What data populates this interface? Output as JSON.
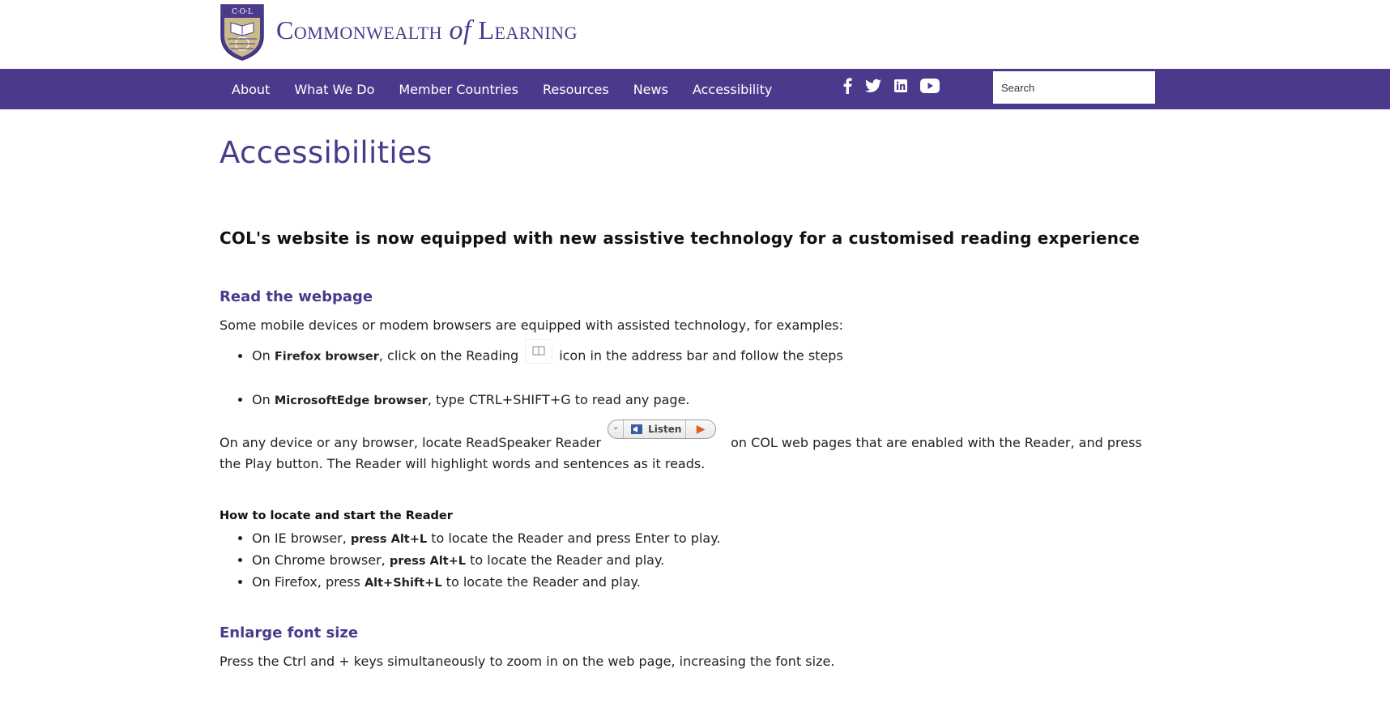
{
  "header": {
    "logo_text_pre": "Commonwealth ",
    "logo_text_of": "of",
    "logo_text_post": " Learning",
    "crest_text": "C·O·L"
  },
  "nav": {
    "items": [
      "About",
      "What We Do",
      "Member Countries",
      "Resources",
      "News",
      "Accessibility"
    ],
    "search_placeholder": "Search"
  },
  "social": [
    "facebook-icon",
    "twitter-icon",
    "linkedin-icon",
    "youtube-icon"
  ],
  "colors": {
    "brand": "#4b3a8c",
    "play": "#e05a1e"
  },
  "main": {
    "title": "Accessibilities",
    "lead": "COL's website is now equipped with new assistive technology for a customised reading experience",
    "section1": {
      "heading": "Read the webpage",
      "intro": "Some mobile devices or modem browsers are equipped with assisted technology, for examples:",
      "b1_pre": "On ",
      "b1_bold": "Firefox browser",
      "b1_mid": ", click on the Reading",
      "b1_post": "icon in the address bar and follow the steps",
      "b2_pre": "On ",
      "b2_bold": "MicrosoftEdge browser",
      "b2_post": ", type CTRL+SHIFT+G to read any page.",
      "reader_pre": "On any device or any browser, locate ReadSpeaker Reader",
      "listen_label": "Listen",
      "reader_post": "on COL web pages that are enabled with the Reader, and press the Play button. The Reader will highlight words and sentences as it reads.",
      "howto_heading": "How to locate and start the Reader",
      "h1_pre": "On IE browser, ",
      "h1_bold": "press Alt+L",
      "h1_post": " to locate the Reader and press Enter to play.",
      "h2_pre": "On Chrome browser, ",
      "h2_bold": "press Alt+L",
      "h2_post": " to locate the Reader and play.",
      "h3_pre": "On Firefox, press ",
      "h3_bold": "Alt+Shift+L",
      "h3_post": " to locate the Reader and play."
    },
    "section2": {
      "heading": "Enlarge font size",
      "text": "Press the Ctrl and + keys simultaneously to zoom in on the web page, increasing the font size."
    }
  }
}
